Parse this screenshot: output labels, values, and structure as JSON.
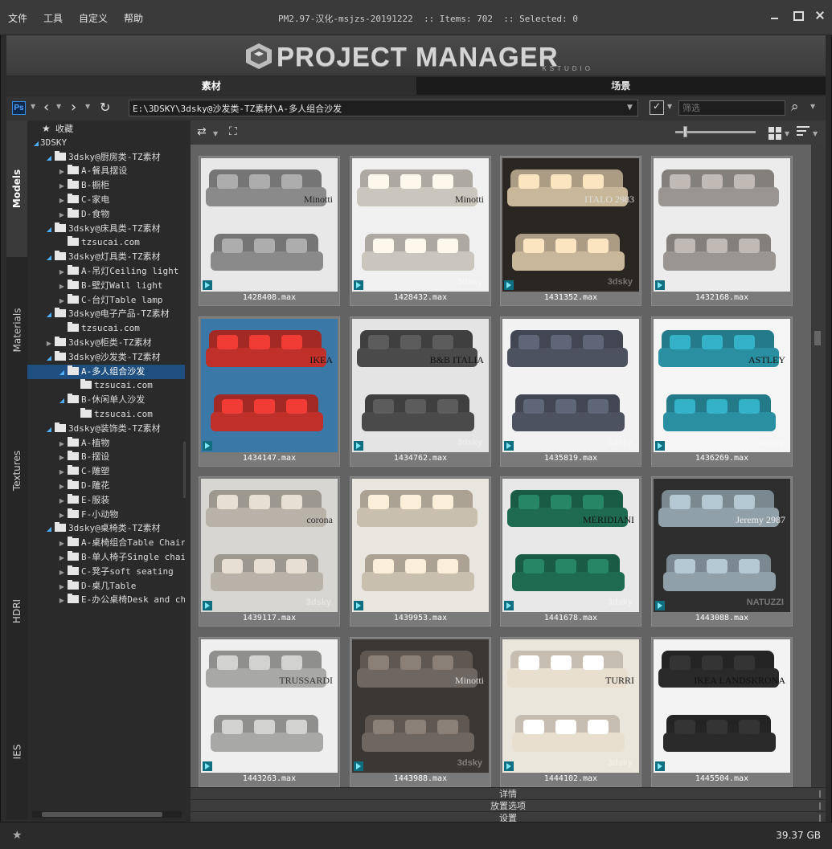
{
  "menu": [
    "文件",
    "工具",
    "自定义",
    "帮助"
  ],
  "window_title": "PM2.97-汉化-msjzs-20191222  :: Items: 702  :: Selected: 0",
  "logo": {
    "title": "PROJECT MANAGER",
    "subtitle": "KSTUDIO"
  },
  "main_tabs": [
    {
      "label": "素材",
      "active": true
    },
    {
      "label": "场景",
      "active": false
    }
  ],
  "pathbar": {
    "ps_label": "Ps",
    "path": "E:\\3DSKY\\3dsky@沙发类-TZ素材\\A-多人组合沙发",
    "filter_placeholder": "筛选"
  },
  "side_tabs": [
    "Models",
    "Materials",
    "Textures",
    "HDRI",
    "IES"
  ],
  "tree": [
    {
      "label": "收藏",
      "level": 0,
      "icon": "star",
      "toggle": "none",
      "selected": false
    },
    {
      "label": "3DSKY",
      "level": 0,
      "icon": "none",
      "toggle": "open",
      "selected": false
    },
    {
      "label": "3dsky@厨房类-TZ素材",
      "level": 1,
      "icon": "folder",
      "toggle": "open",
      "selected": false
    },
    {
      "label": "A-餐具摆设",
      "level": 2,
      "icon": "folder",
      "toggle": "closed",
      "selected": false
    },
    {
      "label": "B-橱柜",
      "level": 2,
      "icon": "folder",
      "toggle": "closed",
      "selected": false
    },
    {
      "label": "C-家电",
      "level": 2,
      "icon": "folder",
      "toggle": "closed",
      "selected": false
    },
    {
      "label": "D-食物",
      "level": 2,
      "icon": "folder",
      "toggle": "closed",
      "selected": false
    },
    {
      "label": "3dsky@床具类-TZ素材",
      "level": 1,
      "icon": "folder",
      "toggle": "open",
      "selected": false
    },
    {
      "label": "tzsucai.com",
      "level": 2,
      "icon": "folder",
      "toggle": "none",
      "selected": false
    },
    {
      "label": "3dsky@灯具类-TZ素材",
      "level": 1,
      "icon": "folder",
      "toggle": "open",
      "selected": false
    },
    {
      "label": "A-吊灯Ceiling light",
      "level": 2,
      "icon": "folder",
      "toggle": "closed",
      "selected": false
    },
    {
      "label": "B-壁灯Wall light",
      "level": 2,
      "icon": "folder",
      "toggle": "closed",
      "selected": false
    },
    {
      "label": "C-台灯Table lamp",
      "level": 2,
      "icon": "folder",
      "toggle": "closed",
      "selected": false
    },
    {
      "label": "3dsky@电子产品-TZ素材",
      "level": 1,
      "icon": "folder",
      "toggle": "open",
      "selected": false
    },
    {
      "label": "tzsucai.com",
      "level": 2,
      "icon": "folder",
      "toggle": "none",
      "selected": false
    },
    {
      "label": "3dsky@柜类-TZ素材",
      "level": 1,
      "icon": "folder",
      "toggle": "closed",
      "selected": false
    },
    {
      "label": "3dsky@沙发类-TZ素材",
      "level": 1,
      "icon": "folder",
      "toggle": "open",
      "selected": false
    },
    {
      "label": "A-多人组合沙发",
      "level": 2,
      "icon": "folder",
      "toggle": "open",
      "selected": true
    },
    {
      "label": "tzsucai.com",
      "level": 3,
      "icon": "folder",
      "toggle": "none",
      "selected": false
    },
    {
      "label": "B-休闲单人沙发",
      "level": 2,
      "icon": "folder",
      "toggle": "open",
      "selected": false
    },
    {
      "label": "tzsucai.com",
      "level": 3,
      "icon": "folder",
      "toggle": "none",
      "selected": false
    },
    {
      "label": "3dsky@装饰类-TZ素材",
      "level": 1,
      "icon": "folder",
      "toggle": "open",
      "selected": false
    },
    {
      "label": "A-植物",
      "level": 2,
      "icon": "folder",
      "toggle": "closed",
      "selected": false
    },
    {
      "label": "B-摆设",
      "level": 2,
      "icon": "folder",
      "toggle": "closed",
      "selected": false
    },
    {
      "label": "C-雕塑",
      "level": 2,
      "icon": "folder",
      "toggle": "closed",
      "selected": false
    },
    {
      "label": "D-雕花",
      "level": 2,
      "icon": "folder",
      "toggle": "closed",
      "selected": false
    },
    {
      "label": "E-服装",
      "level": 2,
      "icon": "folder",
      "toggle": "closed",
      "selected": false
    },
    {
      "label": "F-小动物",
      "level": 2,
      "icon": "folder",
      "toggle": "closed",
      "selected": false
    },
    {
      "label": "3dsky@桌椅类-TZ素材",
      "level": 1,
      "icon": "folder",
      "toggle": "open",
      "selected": false
    },
    {
      "label": "A-桌椅组合Table Chair",
      "level": 2,
      "icon": "folder",
      "toggle": "closed",
      "selected": false
    },
    {
      "label": "B-单人椅子Single chair",
      "level": 2,
      "icon": "folder",
      "toggle": "closed",
      "selected": false
    },
    {
      "label": "C-凳子soft seating",
      "level": 2,
      "icon": "folder",
      "toggle": "closed",
      "selected": false
    },
    {
      "label": "D-桌几Table",
      "level": 2,
      "icon": "folder",
      "toggle": "closed",
      "selected": false
    },
    {
      "label": "E-办公桌椅Desk and chair",
      "level": 2,
      "icon": "folder",
      "toggle": "closed",
      "selected": false
    }
  ],
  "thumbnails": [
    {
      "file": "1428408.max",
      "bg": "#e8e8e8",
      "sofa": "#8a8a8a",
      "text": "Minotti",
      "text_color": "#222",
      "watermark": ""
    },
    {
      "file": "1428432.max",
      "bg": "#f0f0f0",
      "sofa": "#cbc6bd",
      "text": "Minotti",
      "text_color": "#222",
      "watermark": "3dsky"
    },
    {
      "file": "1431352.max",
      "bg": "#2a2622",
      "sofa": "#c9b79a",
      "text": "ITALO 2983",
      "text_color": "#ddd",
      "watermark": "3dsky"
    },
    {
      "file": "1432168.max",
      "bg": "#ececec",
      "sofa": "#9a9590",
      "text": "",
      "text_color": "#222",
      "watermark": ""
    },
    {
      "file": "1434147.max",
      "bg": "#3a78a8",
      "sofa": "#c0302a",
      "text": "IKEA",
      "text_color": "#111",
      "watermark": ""
    },
    {
      "file": "1434762.max",
      "bg": "#e4e4e4",
      "sofa": "#4a4a4a",
      "text": "B&B ITALIA",
      "text_color": "#111",
      "watermark": "3dsky"
    },
    {
      "file": "1435819.max",
      "bg": "#f2f2f2",
      "sofa": "#4c5260",
      "text": "",
      "text_color": "#222",
      "watermark": "3dsky"
    },
    {
      "file": "1436269.max",
      "bg": "#f5f5f5",
      "sofa": "#2a8fa0",
      "text": "ASTLEY",
      "text_color": "#111",
      "watermark": "3dsky"
    },
    {
      "file": "1439117.max",
      "bg": "#d8d6d2",
      "sofa": "#b8b2a8",
      "text": "corona",
      "text_color": "#333",
      "watermark": "3dsky"
    },
    {
      "file": "1439953.max",
      "bg": "#e9e6e0",
      "sofa": "#c9bfae",
      "text": "",
      "text_color": "#222",
      "watermark": ""
    },
    {
      "file": "1441678.max",
      "bg": "#e8e8e8",
      "sofa": "#1e6b52",
      "text": "MERIDIANI",
      "text_color": "#111",
      "watermark": "3dsky"
    },
    {
      "file": "1443088.max",
      "bg": "#2e2e2e",
      "sofa": "#8fa0a8",
      "text": "Jeremy 2987",
      "text_color": "#eee",
      "watermark": "NATUZZI"
    },
    {
      "file": "1443263.max",
      "bg": "#efefef",
      "sofa": "#a8a8a6",
      "text": "TRUSSARDI",
      "text_color": "#333",
      "watermark": ""
    },
    {
      "file": "1443988.max",
      "bg": "#3b3734",
      "sofa": "#6e6660",
      "text": "Minotti",
      "text_color": "#ddd",
      "watermark": "3dsky"
    },
    {
      "file": "1444102.max",
      "bg": "#ebe6dc",
      "sofa": "#e8dfcf",
      "text": "TURRI",
      "text_color": "#222",
      "watermark": "3dsky"
    },
    {
      "file": "1445504.max",
      "bg": "#f3f3f3",
      "sofa": "#2a2a2a",
      "text": "IKEA LANDSKRONA",
      "text_color": "#111",
      "watermark": ""
    }
  ],
  "accordion": [
    "详情",
    "放置选项",
    "设置"
  ],
  "status": {
    "disk_size": "39.37 GB"
  },
  "icons": {
    "ps": "photoshop-icon",
    "back": "back-arrow-icon",
    "forward": "forward-arrow-icon",
    "refresh": "refresh-icon",
    "filter": "filter-icon",
    "search": "search-icon",
    "grid": "grid-view-icon",
    "sort": "sort-icon",
    "star": "star-icon"
  }
}
